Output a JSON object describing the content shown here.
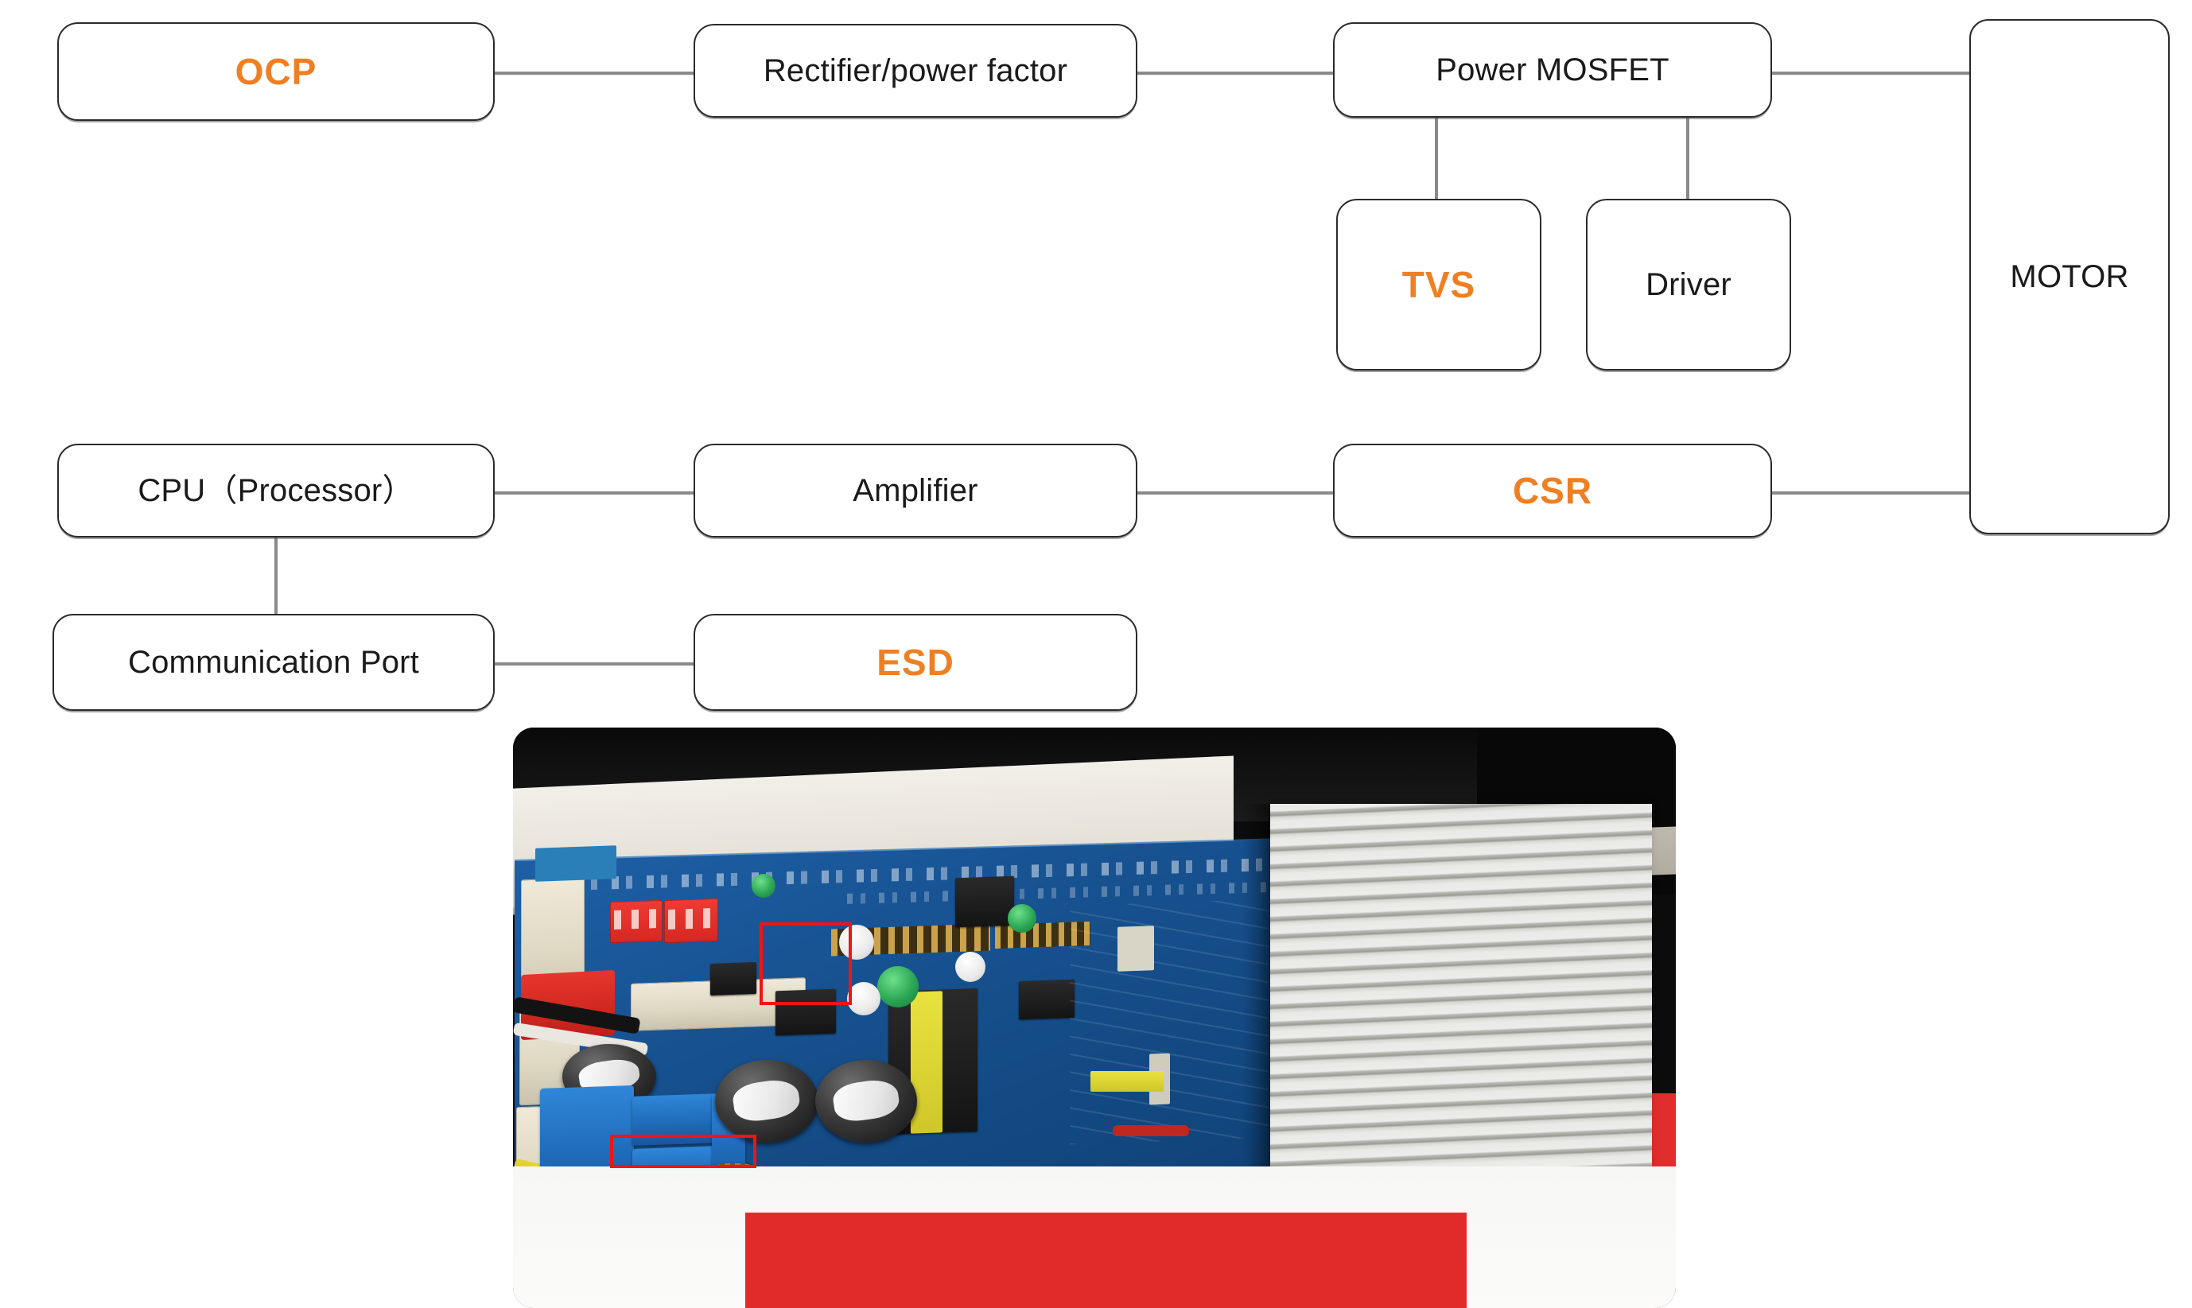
{
  "diagram": {
    "type": "block-diagram",
    "accent_color": "#ef7f23",
    "text_color": "#1a1a1a",
    "box_border_color": "#2b2b2b",
    "connector_color": "#8a8a8a",
    "nodes": [
      {
        "id": "ocp",
        "label": "OCP",
        "accent": true
      },
      {
        "id": "rectifier",
        "label": "Rectifier/power factor",
        "accent": false
      },
      {
        "id": "mosfet",
        "label": "Power MOSFET",
        "accent": false
      },
      {
        "id": "motor",
        "label": "MOTOR",
        "accent": false
      },
      {
        "id": "tvs",
        "label": "TVS",
        "accent": true
      },
      {
        "id": "driver",
        "label": "Driver",
        "accent": false
      },
      {
        "id": "cpu",
        "label": "CPU（Processor）",
        "accent": false
      },
      {
        "id": "amplifier",
        "label": "Amplifier",
        "accent": false
      },
      {
        "id": "csr",
        "label": "CSR",
        "accent": true
      },
      {
        "id": "commport",
        "label": "Communication Port",
        "accent": false
      },
      {
        "id": "esd",
        "label": "ESD",
        "accent": true
      }
    ],
    "connections": [
      {
        "from": "ocp",
        "to": "rectifier",
        "orientation": "horizontal"
      },
      {
        "from": "rectifier",
        "to": "mosfet",
        "orientation": "horizontal"
      },
      {
        "from": "mosfet",
        "to": "motor",
        "orientation": "horizontal"
      },
      {
        "from": "mosfet",
        "to": "tvs",
        "orientation": "vertical"
      },
      {
        "from": "mosfet",
        "to": "driver",
        "orientation": "vertical"
      },
      {
        "from": "cpu",
        "to": "amplifier",
        "orientation": "horizontal"
      },
      {
        "from": "amplifier",
        "to": "csr",
        "orientation": "horizontal"
      },
      {
        "from": "csr",
        "to": "motor",
        "orientation": "horizontal"
      },
      {
        "from": "cpu",
        "to": "commport",
        "orientation": "vertical"
      },
      {
        "from": "commport",
        "to": "esd",
        "orientation": "horizontal"
      }
    ]
  },
  "photo": {
    "subject": "motor-driver-pcb-with-aluminum-heatsink",
    "annotation_color": "#f01414",
    "annotation_count": 2,
    "board_color": "#17518f",
    "heatsink_color": "#d4d4d0",
    "background_strip_color": "#e22d2d"
  }
}
